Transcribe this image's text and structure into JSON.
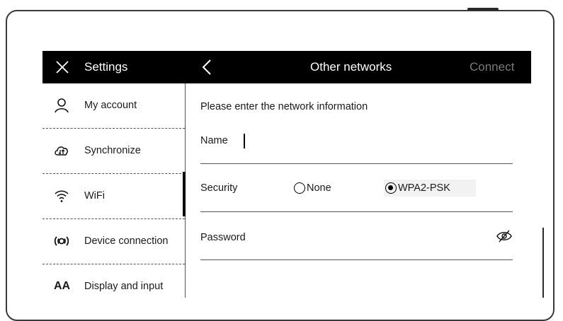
{
  "topbar": {
    "settings_label": "Settings",
    "title": "Other networks",
    "connect_label": "Connect"
  },
  "sidebar": {
    "items": [
      {
        "label": "My account",
        "icon": "person-icon"
      },
      {
        "label": "Synchronize",
        "icon": "cloud-sync-icon"
      },
      {
        "label": "WiFi",
        "icon": "wifi-icon",
        "active": true
      },
      {
        "label": "Device connection",
        "icon": "broadcast-icon"
      },
      {
        "label": "Display and input",
        "icon": "font-size-icon",
        "glyph": "AA"
      }
    ]
  },
  "form": {
    "instruction": "Please enter the network information",
    "name_label": "Name",
    "name_value": "",
    "security_label": "Security",
    "security_options": [
      "None",
      "WPA2-PSK"
    ],
    "security_selected": "WPA2-PSK",
    "password_label": "Password"
  }
}
